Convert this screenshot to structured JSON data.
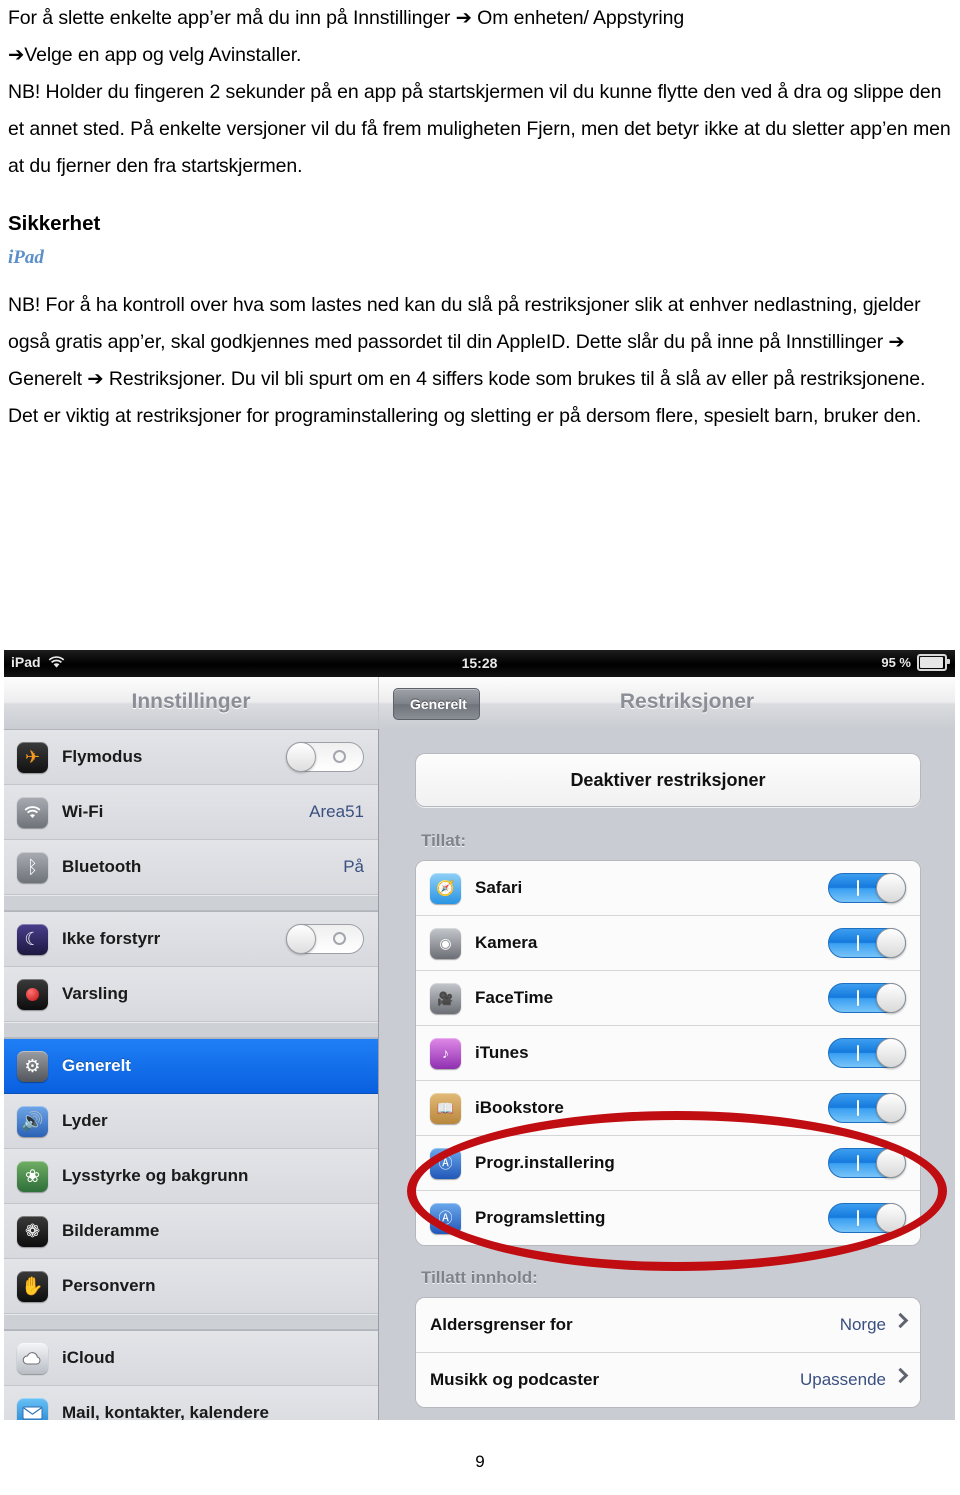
{
  "document": {
    "paragraphs": [
      "For å slette enkelte app’er må du inn på Innstillinger ➔ Om enheten/ Appstyring",
      "➔Velge en app og velg Avinstaller.",
      "NB! Holder du fingeren 2 sekunder på en app på startskjermen vil du kunne flytte den ved å dra og slippe den et annet sted. På enkelte versjoner vil du få frem muligheten Fjern, men det betyr ikke at du sletter app’en men at du fjerner den fra startskjermen."
    ],
    "section_heading": "Sikkerhet",
    "subheading": "iPad",
    "paragraph_after": "NB! For å ha kontroll over hva som lastes ned kan du slå på restriksjoner slik at enhver nedlastning, gjelder også gratis app’er, skal godkjennes med passordet til din AppleID. Dette slår du på inne på Innstillinger ➔ Generelt ➔ Restriksjoner. Du vil bli spurt om en 4 siffers kode som brukes til å slå av eller på restriksjonene. Det er viktig at restriksjoner for programinstallering og sletting er på dersom flere, spesielt barn, bruker den.",
    "page_number": "9"
  },
  "screenshot": {
    "status_bar": {
      "device": "iPad",
      "wifi_icon": "wifi-icon",
      "time": "15:28",
      "battery_percent": "95 %",
      "battery_icon": "battery-icon"
    },
    "nav": {
      "left_title": "Innstillinger",
      "back_button": "Generelt",
      "right_title": "Restriksjoner"
    },
    "sidebar": {
      "groups": [
        {
          "items": [
            {
              "label": "Flymodus",
              "icon": "airplane-icon",
              "control": "toggle",
              "state": "off",
              "value": ""
            },
            {
              "label": "Wi-Fi",
              "icon": "wifi-icon",
              "control": "value",
              "state": "",
              "value": "Area51"
            },
            {
              "label": "Bluetooth",
              "icon": "bluetooth-icon",
              "control": "value",
              "state": "",
              "value": "På"
            }
          ]
        },
        {
          "items": [
            {
              "label": "Ikke forstyrr",
              "icon": "moon-icon",
              "control": "toggle",
              "state": "off",
              "value": ""
            },
            {
              "label": "Varsling",
              "icon": "alert-icon",
              "control": "none",
              "state": "",
              "value": ""
            }
          ]
        },
        {
          "items": [
            {
              "label": "Generelt",
              "icon": "gear-icon",
              "control": "none",
              "state": "",
              "value": "",
              "selected": true
            },
            {
              "label": "Lyder",
              "icon": "speaker-icon",
              "control": "none",
              "state": "",
              "value": ""
            },
            {
              "label": "Lysstyrke og bakgrunn",
              "icon": "flower-icon",
              "control": "none",
              "state": "",
              "value": ""
            },
            {
              "label": "Bilderamme",
              "icon": "pictureframe-icon",
              "control": "none",
              "state": "",
              "value": ""
            },
            {
              "label": "Personvern",
              "icon": "hand-icon",
              "control": "none",
              "state": "",
              "value": ""
            }
          ]
        },
        {
          "items": [
            {
              "label": "iCloud",
              "icon": "cloud-icon",
              "control": "none",
              "state": "",
              "value": ""
            },
            {
              "label": "Mail, kontakter, kalendere",
              "icon": "mail-icon",
              "control": "none",
              "state": "",
              "value": ""
            }
          ]
        }
      ]
    },
    "detail": {
      "disable_button": "Deaktiver restriksjoner",
      "allow_label": "Tillat:",
      "allow_items": [
        {
          "label": "Safari",
          "icon": "safari-icon",
          "state": "on"
        },
        {
          "label": "Kamera",
          "icon": "camera-icon",
          "state": "on"
        },
        {
          "label": "FaceTime",
          "icon": "facetime-icon",
          "state": "on"
        },
        {
          "label": "iTunes",
          "icon": "itunes-icon",
          "state": "on"
        },
        {
          "label": "iBookstore",
          "icon": "ibooks-icon",
          "state": "on"
        },
        {
          "label": "Progr.installering",
          "icon": "appstore-icon",
          "state": "on"
        },
        {
          "label": "Programsletting",
          "icon": "appstore-icon",
          "state": "on"
        }
      ],
      "allowed_content_label": "Tillatt innhold:",
      "content_items": [
        {
          "label": "Aldersgrenser for",
          "value": "Norge"
        },
        {
          "label": "Musikk og podcaster",
          "value": "Upassende"
        }
      ]
    },
    "annotation": {
      "type": "red-ellipse",
      "color": "#c00d11",
      "highlights": [
        "Progr.installering",
        "Programsletting"
      ]
    }
  }
}
